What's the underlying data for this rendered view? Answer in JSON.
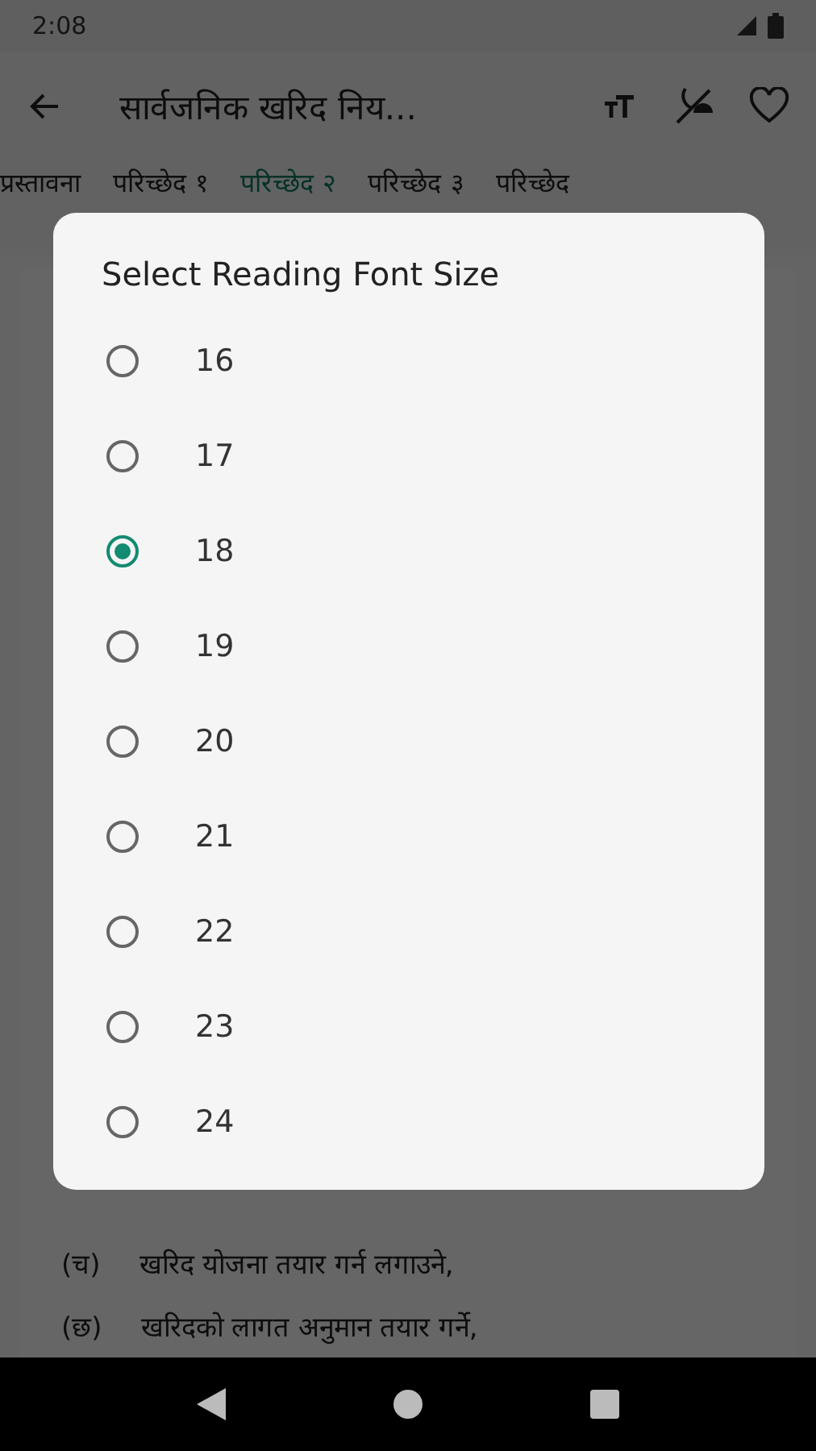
{
  "status_bar": {
    "time": "2:08"
  },
  "app_bar": {
    "title": "सार्वजनिक खरिद निय..."
  },
  "tabs": [
    {
      "label": "प्रस्तावना",
      "selected": false
    },
    {
      "label": "परिच्छेद १",
      "selected": false
    },
    {
      "label": "परिच्छेद २",
      "selected": true
    },
    {
      "label": "परिच्छेद ३",
      "selected": false
    },
    {
      "label": "परिच्छेद",
      "selected": false
    }
  ],
  "content": [
    {
      "marker": "(च)",
      "text": "खरिद योजना तयार गर्न लगाउने,"
    },
    {
      "marker": "(छ)",
      "text": "खरिदको लागत अनुमान तयार गर्ने,"
    }
  ],
  "dialog": {
    "title": "Select Reading Font Size",
    "options": [
      {
        "label": "16",
        "selected": false
      },
      {
        "label": "17",
        "selected": false
      },
      {
        "label": "18",
        "selected": true
      },
      {
        "label": "19",
        "selected": false
      },
      {
        "label": "20",
        "selected": false
      },
      {
        "label": "21",
        "selected": false
      },
      {
        "label": "22",
        "selected": false
      },
      {
        "label": "23",
        "selected": false
      },
      {
        "label": "24",
        "selected": false
      }
    ]
  }
}
